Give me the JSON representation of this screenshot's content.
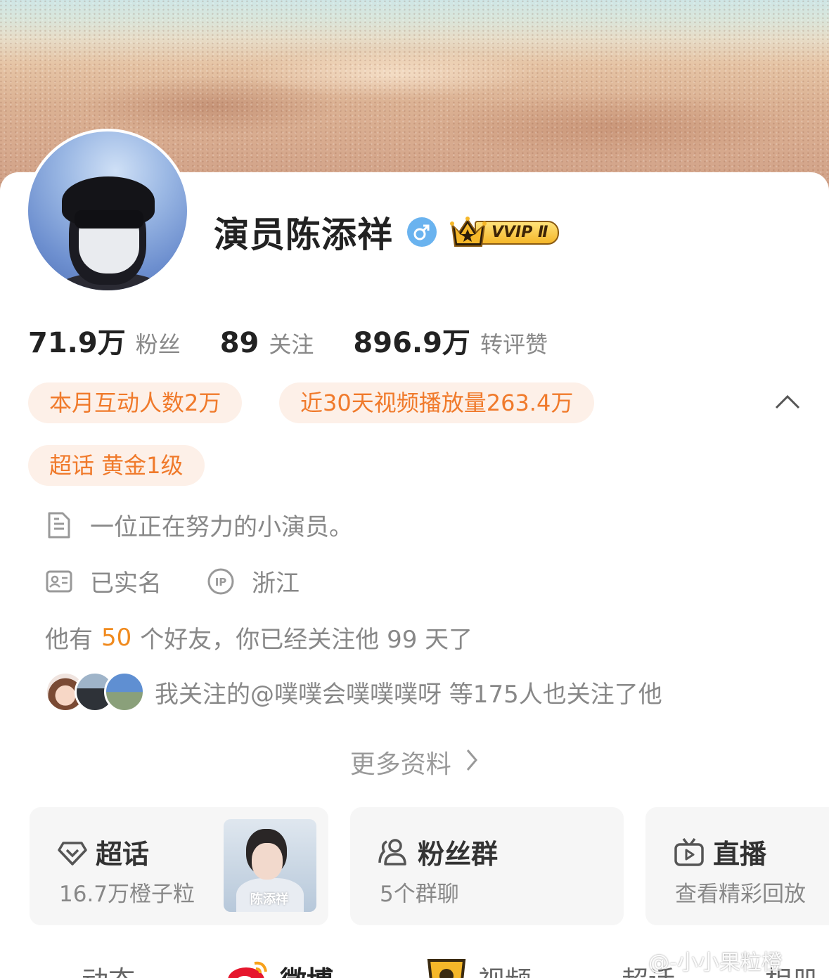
{
  "profile": {
    "name": "演员陈添祥",
    "gender_icon": "male-icon",
    "vip_label": "VVIP Ⅱ"
  },
  "stats": [
    {
      "value": "71.9万",
      "label": "粉丝"
    },
    {
      "value": "89",
      "label": "关注"
    },
    {
      "value": "896.9万",
      "label": "转评赞"
    }
  ],
  "badges": {
    "interaction": "本月互动人数2万",
    "video_views": "近30天视频播放量263.4万",
    "supertopic": "超话 黄金1级"
  },
  "info": {
    "bio": "一位正在努力的小演员。",
    "verified": "已实名",
    "ip_location": "浙江",
    "friends_prefix": "他有",
    "friends_count": "50",
    "friends_suffix": "个好友，你已经关注他 99 天了",
    "mutual_follow_text": "我关注的@噗噗会噗噗噗呀 等175人也关注了他",
    "more_label": "更多资料"
  },
  "tiles": [
    {
      "title": "超话",
      "sub": "16.7万橙子粒",
      "icon": "diamond-icon",
      "poster_name": "陈添祥"
    },
    {
      "title": "粉丝群",
      "sub": "5个群聊",
      "icon": "group-icon"
    },
    {
      "title": "直播",
      "sub": "查看精彩回放",
      "icon": "tv-icon"
    }
  ],
  "tabs": [
    "动态",
    "微博",
    "视频",
    "超话",
    "相册"
  ],
  "watermark": "@-小小果粒橙",
  "colors": {
    "accent_orange": "#f07a2b",
    "pill_bg": "#fdf0e8",
    "gender_blue": "#6ab3ef",
    "vip_gold": "#f5b729"
  }
}
